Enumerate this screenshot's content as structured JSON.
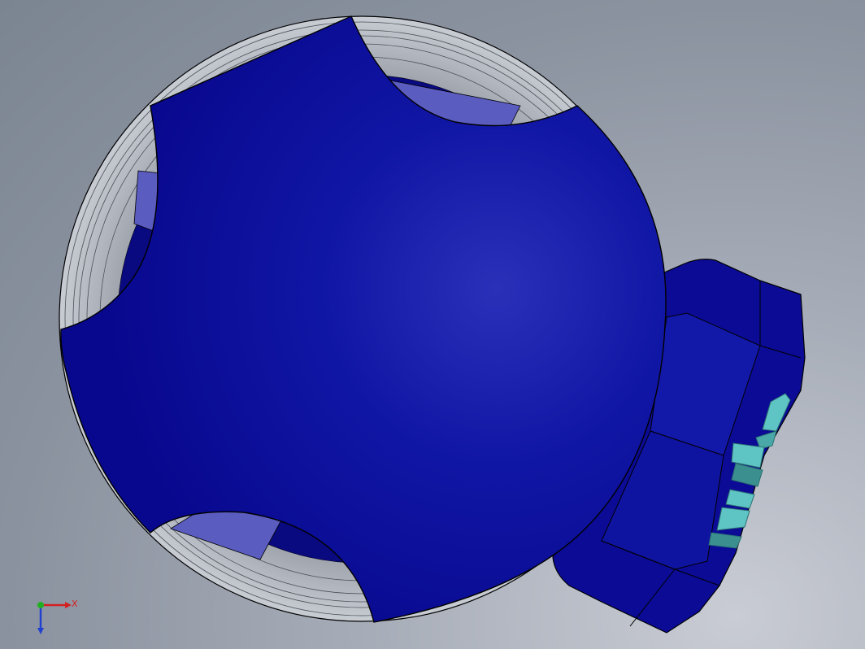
{
  "viewport": {
    "background_top": "#7b8491",
    "background_bottom": "#c9ccd4"
  },
  "model": {
    "body_color": "#0a0a9a",
    "body_highlight": "#2a30b8",
    "ring_color": "#b8bcc4",
    "inner_window_color": "#5a5cc0",
    "connector_color": "#0b0b96",
    "pin_color": "#5fc4c4",
    "edge_color": "#000000"
  },
  "triad": {
    "x_label": "X",
    "x_color": "#d42020",
    "y_color": "#20b020",
    "z_color": "#2040d0"
  }
}
